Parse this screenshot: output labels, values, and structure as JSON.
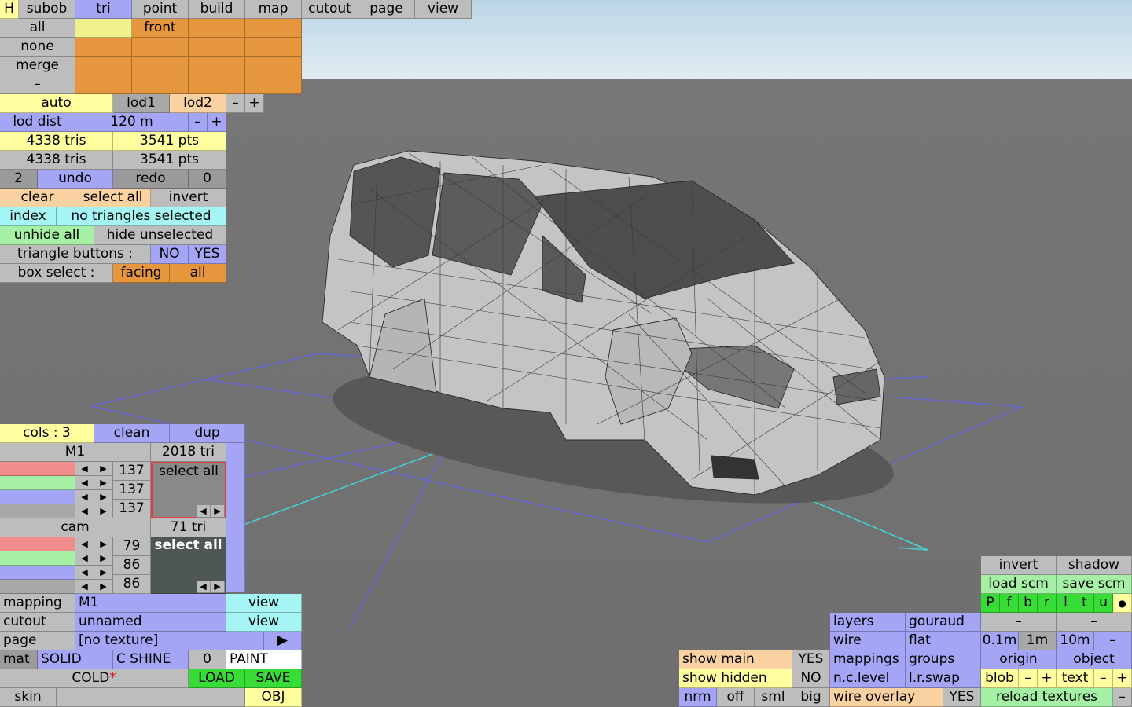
{
  "tabs": {
    "h": "H",
    "subob": "subob",
    "tri": "tri",
    "point": "point",
    "build": "build",
    "map": "map",
    "cutout": "cutout",
    "page": "page",
    "view": "view"
  },
  "select": {
    "all": "all",
    "front": "front",
    "none": "none",
    "merge": "merge",
    "dash": "–"
  },
  "lod": {
    "auto": "auto",
    "lod1": "lod1",
    "lod2": "lod2",
    "minus": "–",
    "plus": "+",
    "dist_label": "lod dist",
    "dist_value": "120 m"
  },
  "stats": {
    "tris1": "4338 tris",
    "pts1": "3541 pts",
    "tris2": "4338 tris",
    "pts2": "3541 pts"
  },
  "history": {
    "count": "2",
    "undo": "undo",
    "redo": "redo",
    "redo_count": "0"
  },
  "triangles": {
    "clear": "clear",
    "select_all": "select all",
    "invert": "invert",
    "index": "index",
    "status": "no triangles selected",
    "unhide_all": "unhide all",
    "hide_unselected": "hide unselected",
    "buttons_label": "triangle buttons :",
    "no": "NO",
    "yes": "YES",
    "box_label": "box select :",
    "facing": "facing",
    "all": "all"
  },
  "material": {
    "cols": "cols : 3",
    "clean": "clean",
    "dup": "dup",
    "m1_name": "M1",
    "m1_tris": "2018 tri",
    "m1_r": "137",
    "m1_g": "137",
    "m1_b": "137",
    "m1_select_all": "select all",
    "cam_name": "cam",
    "cam_tris": "71 tri",
    "cam_r": "79",
    "cam_g": "86",
    "cam_b": "86",
    "cam_select_all": "select all"
  },
  "bottom_left": {
    "mapping": "mapping",
    "mapping_value": "M1",
    "view": "view",
    "cutout": "cutout",
    "cutout_value": "unnamed",
    "page": "page",
    "page_value": "[no texture]",
    "mat": "mat",
    "solid": "SOLID",
    "cshine": "C SHINE",
    "zero": "0",
    "paint": "PAINT",
    "cold": "COLD",
    "star": "*",
    "load": "LOAD",
    "save": "SAVE",
    "skin": "skin",
    "obj": "OBJ"
  },
  "show": {
    "show_main": "show main",
    "yes": "YES",
    "show_hidden": "show hidden",
    "no": "NO",
    "nrm": "nrm",
    "off": "off",
    "sml": "sml",
    "big": "big"
  },
  "render": {
    "layers": "layers",
    "gouraud": "gouraud",
    "wire": "wire",
    "flat": "flat",
    "mappings": "mappings",
    "groups": "groups",
    "nclevel": "n.c.level",
    "lrswap": "l.r.swap",
    "wire_overlay": "wire overlay",
    "yes": "YES"
  },
  "right": {
    "invert": "invert",
    "shadow": "shadow",
    "load_scm": "load scm",
    "save_scm": "save scm",
    "letters": [
      "P",
      "f",
      "b",
      "r",
      "l",
      "t",
      "u"
    ],
    "dot": "●",
    "dash": "–",
    "g01": "0.1m",
    "g1": "1m",
    "g10": "10m",
    "origin": "origin",
    "object": "object",
    "blob": "blob",
    "text": "text",
    "minus": "–",
    "plus": "+",
    "reload": "reload textures"
  },
  "colors": {
    "orange": "#e6963c",
    "yellow": "#ffffa0",
    "blue": "#a5a5f5",
    "green": "#a5f0a5",
    "cyan": "#a5f5f5",
    "peach": "#fad2a2",
    "lime": "#37dc37",
    "grid": "#6464d2",
    "axis": "#46d2d2"
  }
}
